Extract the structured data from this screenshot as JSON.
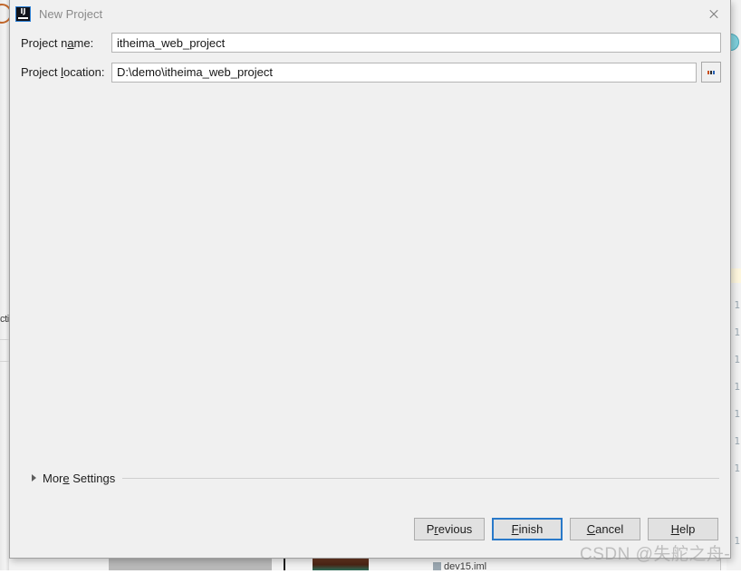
{
  "dialog": {
    "title": "New Project",
    "logo_text": "IJ",
    "close_label": "×",
    "fields": [
      {
        "label_before": "Project n",
        "label_mnemonic": "a",
        "label_after": "me:",
        "value": "itheima_web_project",
        "placeholder": "",
        "has_browse": false
      },
      {
        "label_before": "Project ",
        "label_mnemonic": "l",
        "label_after": "ocation:",
        "value": "D:\\demo\\itheima_web_project",
        "placeholder": "",
        "has_browse": true,
        "browse_label": "..."
      }
    ],
    "more_settings": {
      "label_before": "Mor",
      "label_mnemonic": "e",
      "label_after": " Settings",
      "expanded": false
    },
    "buttons": [
      {
        "label_before": "P",
        "label_mnemonic": "r",
        "label_after": "evious",
        "focused": false
      },
      {
        "label_before": "",
        "label_mnemonic": "F",
        "label_after": "inish",
        "focused": true
      },
      {
        "label_before": "",
        "label_mnemonic": "C",
        "label_after": "ancel",
        "focused": false
      },
      {
        "label_before": "",
        "label_mnemonic": "H",
        "label_after": "elp",
        "focused": false
      }
    ]
  },
  "background": {
    "left_edge_text": "cti",
    "bottom_file_name": "dev15.iml",
    "gutter_line_numbers": [
      "1",
      "1",
      "1",
      "1",
      "1",
      "1",
      "1",
      "1"
    ]
  },
  "watermark": {
    "text": "CSDN @失舵之舟-"
  },
  "colors": {
    "dialog_bg": "#f0f0f0",
    "focus_blue": "#2979c9",
    "title_text": "#8a8a8a",
    "teal_accent": "#7fd0dc"
  }
}
